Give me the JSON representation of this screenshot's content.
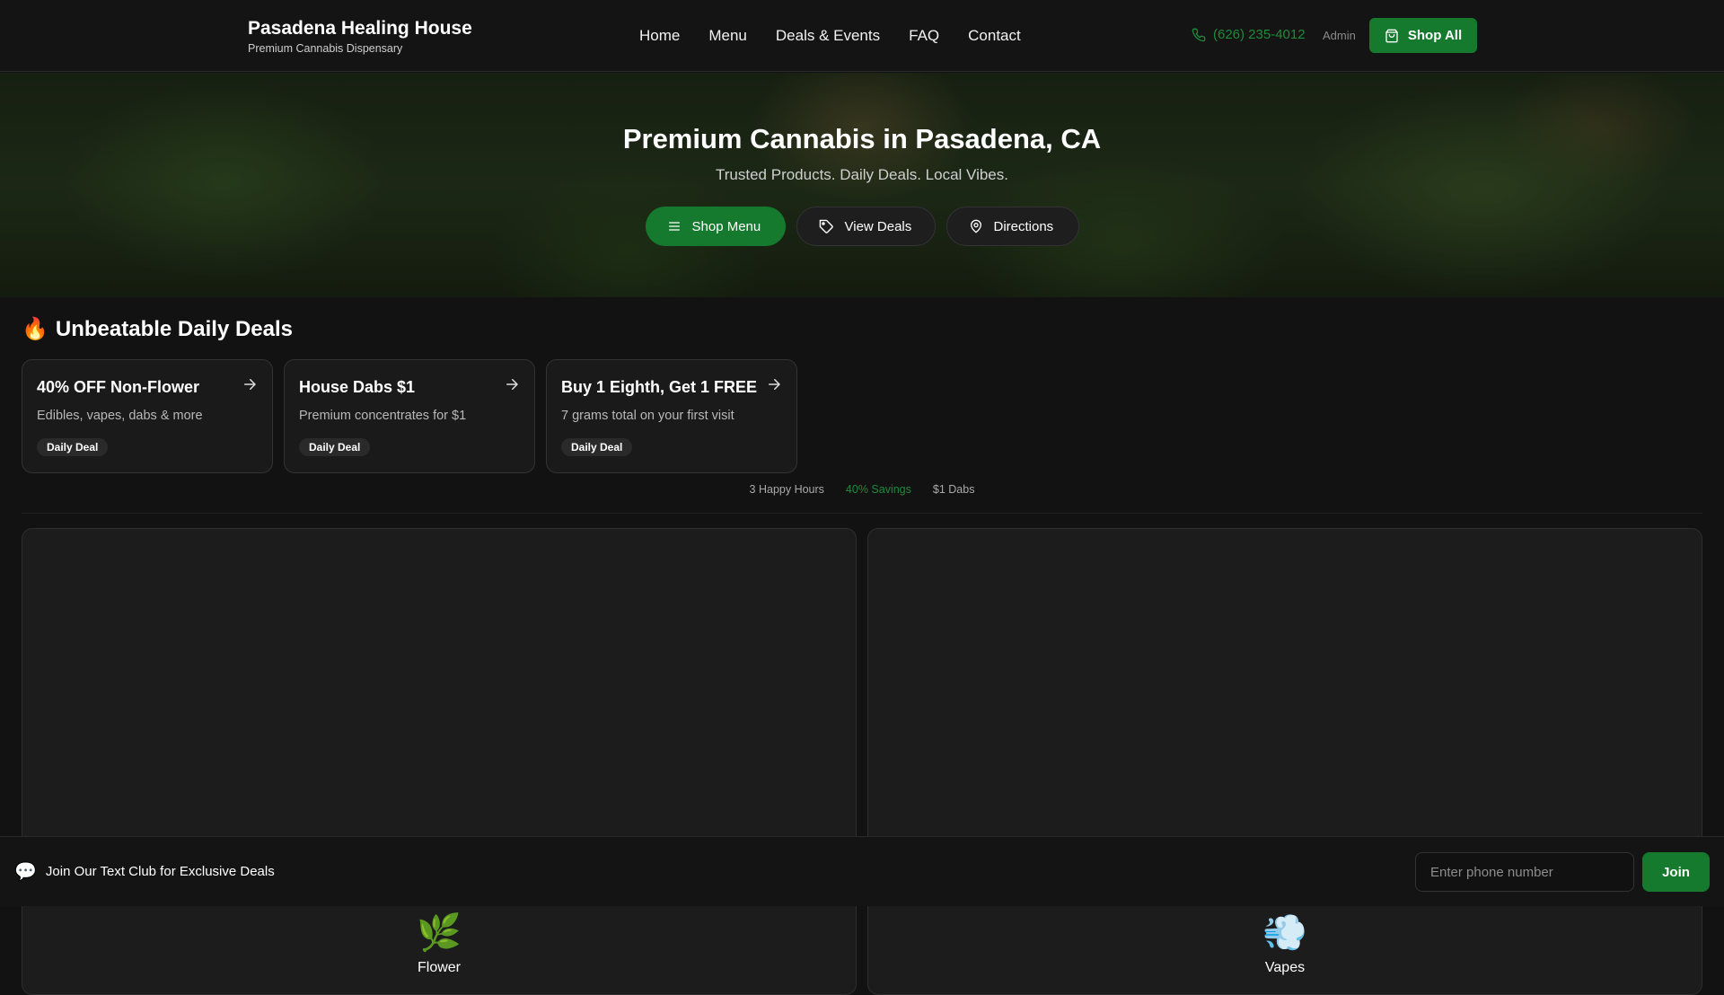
{
  "brand": {
    "title": "Pasadena Healing House",
    "subtitle": "Premium Cannabis Dispensary"
  },
  "nav": [
    "Home",
    "Menu",
    "Deals & Events",
    "FAQ",
    "Contact"
  ],
  "header": {
    "phone": "(626) 235-4012",
    "admin": "Admin",
    "shop_all": "Shop All"
  },
  "hero": {
    "title": "Premium Cannabis in Pasadena, CA",
    "subtitle": "Trusted Products. Daily Deals. Local Vibes.",
    "buttons": [
      "Shop Menu",
      "View Deals",
      "Directions"
    ]
  },
  "deals": {
    "heading_icon": "🔥",
    "heading": "Unbeatable Daily Deals",
    "cards": [
      {
        "title": "40% OFF Non-Flower",
        "desc": "Edibles, vapes, dabs & more",
        "badge": "Daily Deal"
      },
      {
        "title": "House Dabs $1",
        "desc": "Premium concentrates for $1",
        "badge": "Daily Deal"
      },
      {
        "title": "Buy 1 Eighth, Get 1 FREE",
        "desc": "7 grams total on your first visit",
        "badge": "Daily Deal"
      }
    ],
    "stats": [
      "3 Happy Hours",
      "40% Savings",
      "$1 Dabs"
    ]
  },
  "categories": [
    {
      "emoji": "🌿",
      "label": "Flower"
    },
    {
      "emoji": "💨",
      "label": "Vapes"
    }
  ],
  "text_club": {
    "icon": "💬",
    "label": "Join Our Text Club for Exclusive Deals",
    "placeholder": "Enter phone number",
    "join": "Join"
  },
  "colors": {
    "accent": "#167a2e",
    "accent_text": "#1f8a3a",
    "background": "#121212"
  }
}
